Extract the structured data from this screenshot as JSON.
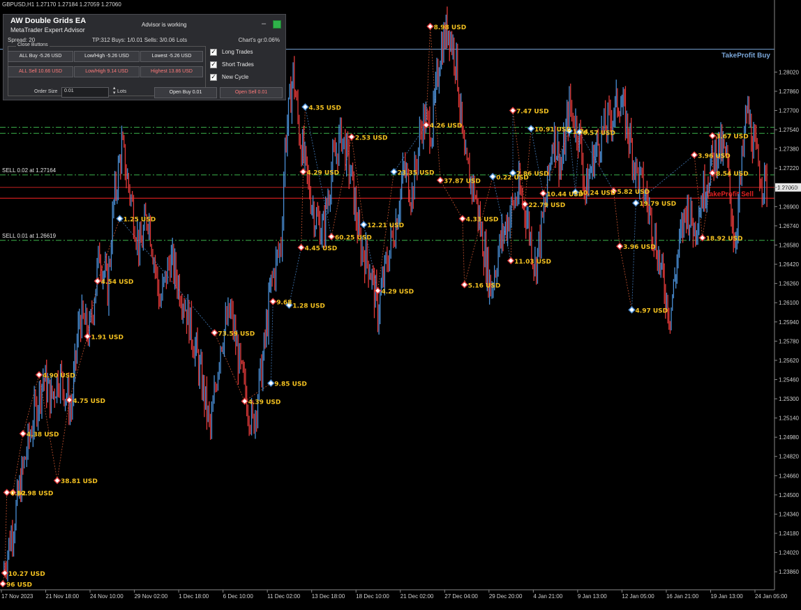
{
  "header": {
    "symbol_info": "GBPUSD,H1  1.27170 1.27184 1.27059 1.27060"
  },
  "panel": {
    "title": "AW Double Grids EA",
    "subtitle": "MetaTrader Expert Advisor",
    "status": "Advisor is working",
    "minimize_label": "–",
    "spread": "Spread: 20",
    "tp_info": "TP:312  Buys: 1/0.01  Sells: 3/0.06  Lots",
    "chart_gr": "Chart's gr:0.06%",
    "close_buttons_label": "Close Buttons",
    "buttons": {
      "all_buy": "ALL Buy -5.26 USD",
      "low_high_buy": "Low/High -5.26 USD",
      "lowest": "Lowest -5.26 USD",
      "all_sell": "ALL Sell 10.66 USD",
      "low_high_sell": "Low/High 9.14 USD",
      "highest": "Highest 13.86 USD",
      "open_buy": "Open Buy 0.01",
      "open_sell": "Open Sell 0.01"
    },
    "checkboxes": [
      {
        "label": "Long Trades",
        "checked": true
      },
      {
        "label": "Short Trades",
        "checked": true
      },
      {
        "label": "New Cycle",
        "checked": true
      }
    ],
    "order_size_label": "Order Size",
    "order_size_value": "0.01",
    "lots_label": "Lots"
  },
  "levels": {
    "tp_buy": {
      "label": "TakeProfit Buy",
      "price": 1.2821,
      "color": "#7aa6d8"
    },
    "tp_sell": {
      "label": "TakeProfit Sell",
      "price": 1.2697,
      "color": "#e02020"
    },
    "sell_lines": [
      {
        "label": "SELL 0.02 at 1.27164",
        "price": 1.27164
      },
      {
        "label": "SELL 0.01 at 1.26619",
        "price": 1.26619
      }
    ],
    "buy_grid_dashdot": [
      1.2756,
      1.2751
    ],
    "current_price": 1.2706,
    "current_price_label": "1.27060"
  },
  "chart_data": {
    "type": "candlestick",
    "symbol": "GBPUSD",
    "timeframe": "H1",
    "ylim": [
      1.2371,
      1.2862
    ],
    "y_ticks": [
      "1.28020",
      "1.27860",
      "1.27700",
      "1.27540",
      "1.27380",
      "1.27220",
      "1.27060",
      "1.26900",
      "1.26740",
      "1.26580",
      "1.26420",
      "1.26260",
      "1.26100",
      "1.25940",
      "1.25780",
      "1.25620",
      "1.25460",
      "1.25300",
      "1.25140",
      "1.24980",
      "1.24820",
      "1.24660",
      "1.24500",
      "1.24340",
      "1.24180",
      "1.24020",
      "1.23860"
    ],
    "x_ticks": [
      "17 Nov 2023",
      "21 Nov 18:00",
      "24 Nov 10:00",
      "29 Nov 02:00",
      "1 Dec 18:00",
      "6 Dec 10:00",
      "11 Dec 02:00",
      "13 Dec 18:00",
      "18 Dec 10:00",
      "21 Dec 02:00",
      "27 Dec 04:00",
      "29 Dec 20:00",
      "4 Jan 21:00",
      "9 Jan 13:00",
      "12 Jan 05:00",
      "16 Jan 21:00",
      "19 Jan 13:00",
      "24 Jan 05:00"
    ],
    "x_tick_index": [
      0,
      1,
      2,
      3,
      4,
      5,
      6,
      7,
      8,
      9,
      10,
      11,
      12,
      13,
      14,
      15,
      16,
      17
    ],
    "path_points": [
      [
        0.0,
        1.2385
      ],
      [
        0.6,
        1.2432
      ],
      [
        1.0,
        1.2471
      ],
      [
        1.5,
        1.2512
      ],
      [
        2.0,
        1.2548
      ],
      [
        2.4,
        1.253
      ],
      [
        2.8,
        1.2551
      ],
      [
        3.4,
        1.2521
      ],
      [
        3.8,
        1.2598
      ],
      [
        4.3,
        1.2584
      ],
      [
        4.8,
        1.2652
      ],
      [
        5.2,
        1.2622
      ],
      [
        5.5,
        1.2692
      ],
      [
        5.9,
        1.274
      ],
      [
        6.3,
        1.2702
      ],
      [
        6.8,
        1.2653
      ],
      [
        7.2,
        1.2686
      ],
      [
        7.8,
        1.2609
      ],
      [
        8.3,
        1.2647
      ],
      [
        9.0,
        1.2612
      ],
      [
        9.6,
        1.2568
      ],
      [
        10.0,
        1.2532
      ],
      [
        10.3,
        1.2502
      ],
      [
        10.8,
        1.2578
      ],
      [
        11.3,
        1.2602
      ],
      [
        11.8,
        1.2552
      ],
      [
        12.4,
        1.2508
      ],
      [
        12.9,
        1.2561
      ],
      [
        13.3,
        1.2625
      ],
      [
        13.8,
        1.266
      ],
      [
        14.0,
        1.2741
      ],
      [
        14.4,
        1.2801
      ],
      [
        14.7,
        1.2753
      ],
      [
        15.1,
        1.2712
      ],
      [
        15.5,
        1.2681
      ],
      [
        15.9,
        1.267
      ],
      [
        16.3,
        1.272
      ],
      [
        16.8,
        1.2751
      ],
      [
        17.3,
        1.2713
      ],
      [
        17.7,
        1.2659
      ],
      [
        18.2,
        1.2641
      ],
      [
        18.6,
        1.2602
      ],
      [
        19.0,
        1.264
      ],
      [
        19.5,
        1.2678
      ],
      [
        19.9,
        1.2721
      ],
      [
        20.3,
        1.27
      ],
      [
        20.8,
        1.2762
      ],
      [
        21.3,
        1.2755
      ],
      [
        21.7,
        1.2821
      ],
      [
        22.1,
        1.284
      ],
      [
        22.5,
        1.281
      ],
      [
        22.9,
        1.2725
      ],
      [
        23.4,
        1.2703
      ],
      [
        23.8,
        1.2661
      ],
      [
        24.2,
        1.2622
      ],
      [
        24.7,
        1.2661
      ],
      [
        25.1,
        1.2682
      ],
      [
        25.6,
        1.2703
      ],
      [
        26.0,
        1.2682
      ],
      [
        26.4,
        1.264
      ],
      [
        26.9,
        1.269
      ],
      [
        27.3,
        1.2752
      ],
      [
        27.7,
        1.2722
      ],
      [
        28.1,
        1.2773
      ],
      [
        28.6,
        1.275
      ],
      [
        28.9,
        1.2701
      ],
      [
        29.3,
        1.2732
      ],
      [
        29.7,
        1.275
      ],
      [
        30.2,
        1.2765
      ],
      [
        30.6,
        1.278
      ],
      [
        31.0,
        1.2755
      ],
      [
        31.4,
        1.272
      ],
      [
        31.9,
        1.2698
      ],
      [
        32.3,
        1.2668
      ],
      [
        32.7,
        1.2632
      ],
      [
        33.1,
        1.26
      ],
      [
        33.5,
        1.2652
      ],
      [
        33.9,
        1.269
      ],
      [
        34.3,
        1.2672
      ],
      [
        34.7,
        1.27
      ],
      [
        35.1,
        1.2723
      ],
      [
        35.5,
        1.2741
      ],
      [
        35.9,
        1.2729
      ],
      [
        36.3,
        1.266
      ],
      [
        36.6,
        1.2712
      ],
      [
        36.9,
        1.2772
      ],
      [
        37.3,
        1.2735
      ],
      [
        37.6,
        1.2716
      ],
      [
        37.9,
        1.2706
      ]
    ],
    "markers": [
      {
        "i": 0.1,
        "price": 1.2385,
        "label": "10.27 USD",
        "color": "#e23a3a"
      },
      {
        "i": 0.5,
        "price": 1.2452,
        "label": "10.98 USD",
        "color": "#e23a3a"
      },
      {
        "i": 1.0,
        "price": 1.2501,
        "label": "4.38 USD",
        "color": "#e23a3a"
      },
      {
        "i": 1.8,
        "price": 1.255,
        "label": "4.90 USD",
        "color": "#e23a3a"
      },
      {
        "i": 2.7,
        "price": 1.2462,
        "label": "38.81 USD",
        "color": "#e23a3a"
      },
      {
        "i": 3.3,
        "price": 1.2529,
        "label": "4.75 USD",
        "color": "#e23a3a"
      },
      {
        "i": 4.2,
        "price": 1.2582,
        "label": "1.91 USD",
        "color": "#e23a3a"
      },
      {
        "i": 4.7,
        "price": 1.2628,
        "label": "4.54 USD",
        "color": "#e23a3a"
      },
      {
        "i": 5.8,
        "price": 1.268,
        "label": "1.25 USD",
        "color": "#4a8fd6"
      },
      {
        "i": 10.5,
        "price": 1.2585,
        "label": "73.59 USD",
        "color": "#e23a3a"
      },
      {
        "i": 12.0,
        "price": 1.2528,
        "label": "4.39 USD",
        "color": "#e23a3a"
      },
      {
        "i": 13.3,
        "price": 1.2543,
        "label": "9.85 USD",
        "color": "#4a8fd6"
      },
      {
        "i": 13.4,
        "price": 1.2611,
        "label": "9.68",
        "color": "#e23a3a"
      },
      {
        "i": 14.2,
        "price": 1.2608,
        "label": "1.28 USD",
        "color": "#4a8fd6"
      },
      {
        "i": 14.8,
        "price": 1.2656,
        "label": "4.45 USD",
        "color": "#e23a3a"
      },
      {
        "i": 14.9,
        "price": 1.2719,
        "label": "4.29 USD",
        "color": "#e23a3a"
      },
      {
        "i": 15.0,
        "price": 1.2773,
        "label": "4.35 USD",
        "color": "#4a8fd6"
      },
      {
        "i": 16.3,
        "price": 1.2665,
        "label": "60.25 USD",
        "color": "#e23a3a"
      },
      {
        "i": 17.3,
        "price": 1.2748,
        "label": "2.53 USD",
        "color": "#e23a3a"
      },
      {
        "i": 17.9,
        "price": 1.2675,
        "label": "12.21 USD",
        "color": "#4a8fd6"
      },
      {
        "i": 18.6,
        "price": 1.262,
        "label": "4.29 USD",
        "color": "#e23a3a"
      },
      {
        "i": 19.4,
        "price": 1.2719,
        "label": "23.35 USD",
        "color": "#4a8fd6"
      },
      {
        "i": 21.0,
        "price": 1.2758,
        "label": "4.26 USD",
        "color": "#e23a3a"
      },
      {
        "i": 21.2,
        "price": 1.284,
        "label": "8.98 USD",
        "color": "#e23a3a"
      },
      {
        "i": 21.7,
        "price": 1.2712,
        "label": "37.87 USD",
        "color": "#e23a3a"
      },
      {
        "i": 22.8,
        "price": 1.268,
        "label": "4.33 USD",
        "color": "#e23a3a"
      },
      {
        "i": 22.9,
        "price": 1.2625,
        "label": "5.16 USD",
        "color": "#e23a3a"
      },
      {
        "i": 24.3,
        "price": 1.2715,
        "label": "0.22 USD",
        "color": "#4a8fd6"
      },
      {
        "i": 25.2,
        "price": 1.2645,
        "label": "11.03 USD",
        "color": "#e23a3a"
      },
      {
        "i": 25.3,
        "price": 1.2718,
        "label": "2.86 USD",
        "color": "#4a8fd6"
      },
      {
        "i": 25.3,
        "price": 1.277,
        "label": "7.47 USD",
        "color": "#e23a3a"
      },
      {
        "i": 25.9,
        "price": 1.2692,
        "label": "22.79 USD",
        "color": "#e23a3a"
      },
      {
        "i": 26.2,
        "price": 1.2755,
        "label": "10.91 USD",
        "color": "#4a8fd6"
      },
      {
        "i": 26.8,
        "price": 1.2701,
        "label": "10.44 USD",
        "color": "#e23a3a"
      },
      {
        "i": 28.1,
        "price": 1.2753,
        "label": "1.74",
        "color": "#4a8fd6"
      },
      {
        "i": 28.4,
        "price": 1.2702,
        "label": "10.24 USD",
        "color": "#4a8fd6"
      },
      {
        "i": 28.6,
        "price": 1.2752,
        "label": "0.57 USD",
        "color": "#4a8fd6"
      },
      {
        "i": 30.3,
        "price": 1.2703,
        "label": "5.82 USD",
        "color": "#e23a3a"
      },
      {
        "i": 30.6,
        "price": 1.2657,
        "label": "3.96 USD",
        "color": "#e23a3a"
      },
      {
        "i": 31.4,
        "price": 1.2693,
        "label": "19.79 USD",
        "color": "#4a8fd6"
      },
      {
        "i": 31.2,
        "price": 1.2604,
        "label": "4.97 USD",
        "color": "#4a8fd6"
      },
      {
        "i": 34.3,
        "price": 1.2733,
        "label": "3.96 USD",
        "color": "#e23a3a"
      },
      {
        "i": 34.7,
        "price": 1.2664,
        "label": "18.92 USD",
        "color": "#e23a3a"
      },
      {
        "i": 35.2,
        "price": 1.2718,
        "label": "8.54 USD",
        "color": "#e23a3a"
      },
      {
        "i": 35.2,
        "price": 1.2749,
        "label": "3.67 USD",
        "color": "#e23a3a"
      },
      {
        "i": 0.0,
        "price": 1.2376,
        "label": "96 USD",
        "color": "#e23a3a"
      },
      {
        "i": 0.2,
        "price": 1.2452,
        "label": "0.62",
        "color": "#e23a3a"
      }
    ],
    "colors": {
      "bull": "#4a8fd6",
      "bear": "#e23a3a",
      "label": "#f2c020",
      "axis_text": "#d0d0d0"
    }
  }
}
